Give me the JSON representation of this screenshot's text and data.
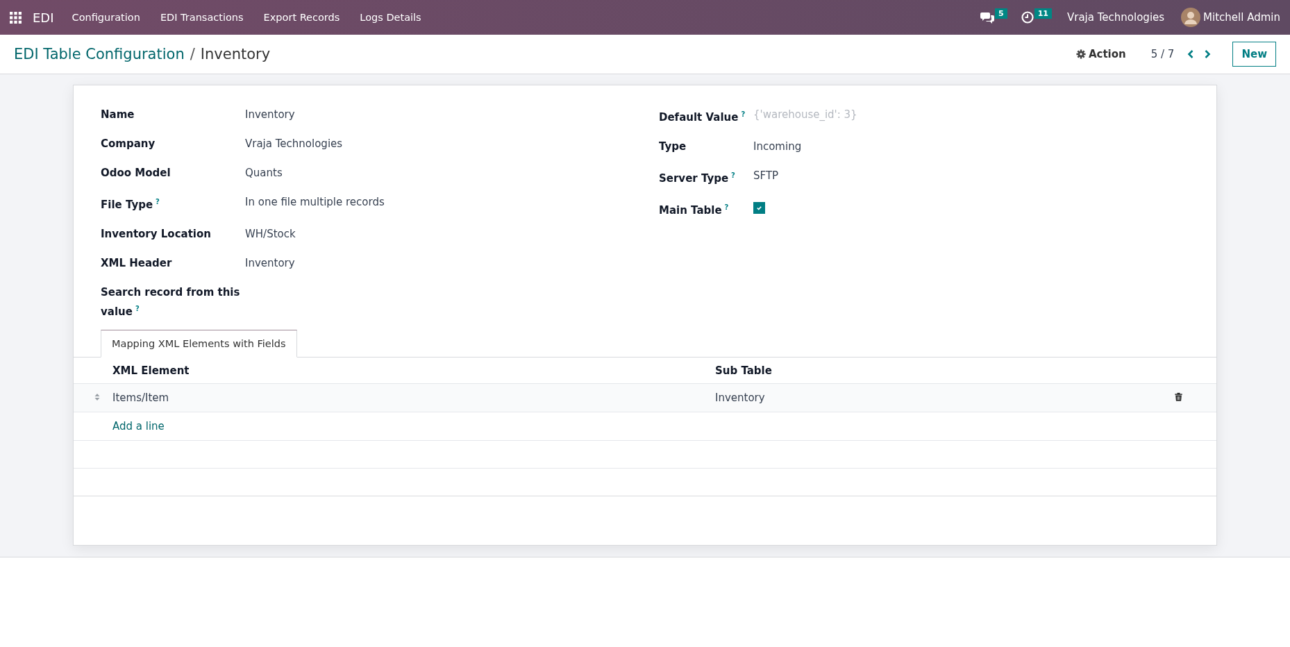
{
  "navbar": {
    "app": "EDI",
    "menus": [
      "Configuration",
      "EDI Transactions",
      "Export Records",
      "Logs Details"
    ],
    "messages_count": "5",
    "activities_count": "11",
    "company": "Vraja Technologies",
    "user": "Mitchell Admin"
  },
  "breadcrumb": {
    "parent": "EDI Table Configuration",
    "separator": "/",
    "current": "Inventory"
  },
  "controls": {
    "action": "Action",
    "pager": "5 / 7",
    "new": "New"
  },
  "left_fields": [
    {
      "label": "Name",
      "kind": "text",
      "value": "Inventory"
    },
    {
      "label": "Company",
      "kind": "text",
      "value": "Vraja Technologies"
    },
    {
      "label": "Odoo Model",
      "kind": "text",
      "value": "Quants"
    },
    {
      "label": "File Type",
      "help": "?",
      "kind": "text",
      "value": "In one file multiple records"
    },
    {
      "label": "Inventory Location",
      "kind": "text",
      "value": "WH/Stock"
    },
    {
      "label": "XML Header",
      "kind": "text",
      "value": "Inventory"
    },
    {
      "label": "Search record from this value",
      "help": "?",
      "kind": "text"
    }
  ],
  "right_fields": [
    {
      "label": "Default Value",
      "help": "?",
      "kind": "text",
      "placeholder": "{'warehouse_id': 3}"
    },
    {
      "label": "Type",
      "kind": "text",
      "value": "Incoming"
    },
    {
      "label": "Server Type",
      "help": "?",
      "kind": "text",
      "value": "SFTP"
    },
    {
      "label": "Main Table",
      "help": "?",
      "kind": "checkbox",
      "checked": true
    }
  ],
  "tabs": [
    {
      "label": "Mapping XML Elements with Fields",
      "selected": true
    }
  ],
  "table": {
    "columns": [
      "XML Element",
      "Sub Table"
    ],
    "rows": [
      {
        "cells": [
          "Items/Item",
          "Inventory"
        ]
      }
    ],
    "add_line": "Add a line"
  }
}
